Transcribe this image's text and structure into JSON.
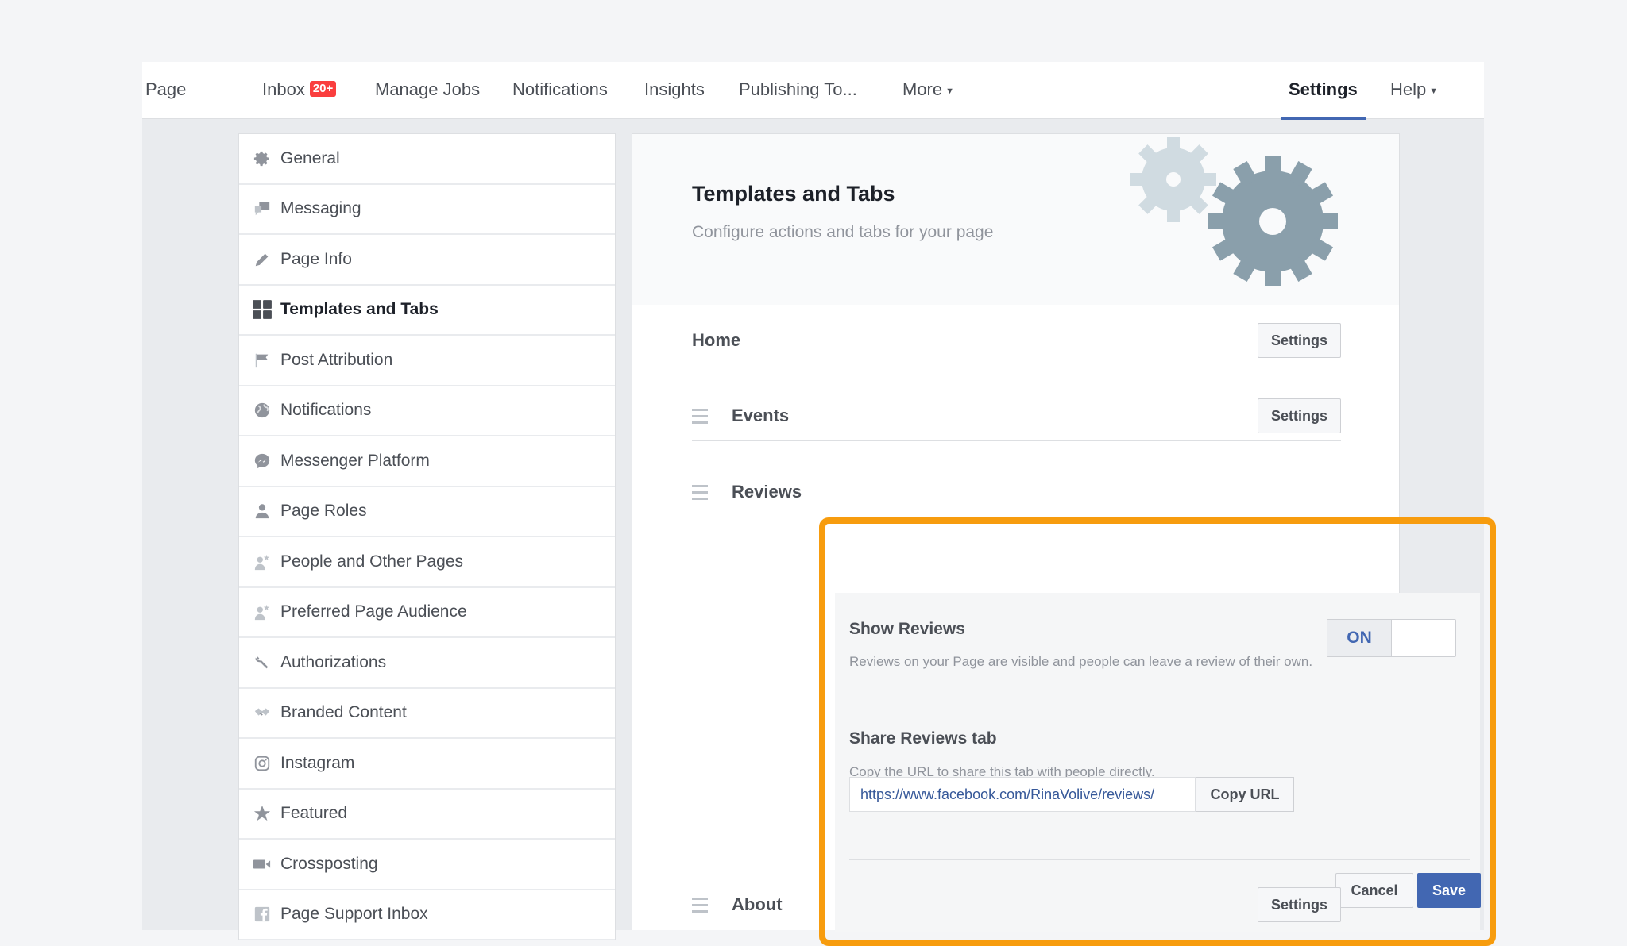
{
  "topnav": {
    "items": [
      {
        "label": "Page"
      },
      {
        "label": "Inbox",
        "badge": "20+"
      },
      {
        "label": "Manage Jobs"
      },
      {
        "label": "Notifications"
      },
      {
        "label": "Insights"
      },
      {
        "label": "Publishing To..."
      },
      {
        "label": "More"
      }
    ],
    "right": [
      {
        "label": "Settings",
        "active": true
      },
      {
        "label": "Help"
      }
    ]
  },
  "sidebar": {
    "items": [
      {
        "label": "General",
        "icon": "gear-icon"
      },
      {
        "label": "Messaging",
        "icon": "chat-bubbles-icon"
      },
      {
        "label": "Page Info",
        "icon": "pencil-icon"
      },
      {
        "label": "Templates and Tabs",
        "icon": "grid-icon",
        "active": true
      },
      {
        "label": "Post Attribution",
        "icon": "flag-icon"
      },
      {
        "label": "Notifications",
        "icon": "globe-icon"
      },
      {
        "label": "Messenger Platform",
        "icon": "messenger-icon"
      },
      {
        "label": "Page Roles",
        "icon": "person-icon"
      },
      {
        "label": "People and Other Pages",
        "icon": "person-star-icon"
      },
      {
        "label": "Preferred Page Audience",
        "icon": "person-star-icon"
      },
      {
        "label": "Authorizations",
        "icon": "wrench-icon"
      },
      {
        "label": "Branded Content",
        "icon": "handshake-icon"
      },
      {
        "label": "Instagram",
        "icon": "instagram-icon"
      },
      {
        "label": "Featured",
        "icon": "star-icon"
      },
      {
        "label": "Crossposting",
        "icon": "video-camera-icon"
      },
      {
        "label": "Page Support Inbox",
        "icon": "facebook-icon"
      }
    ]
  },
  "main": {
    "title": "Templates and Tabs",
    "subtitle": "Configure actions and tabs for your page",
    "tabs": [
      {
        "label": "Home",
        "button": "Settings"
      },
      {
        "label": "Events",
        "button": "Settings"
      },
      {
        "label": "Reviews"
      },
      {
        "label": "About",
        "button": "Settings"
      }
    ],
    "reviews": {
      "show_label": "Show Reviews",
      "show_desc": "Reviews on your Page are visible and people can leave a review of their own.",
      "toggle_state": "ON",
      "share_label": "Share Reviews tab",
      "share_desc": "Copy the URL to share this tab with people directly.",
      "url_value": "https://www.facebook.com/RinaVolive/reviews/",
      "copy_button": "Copy URL",
      "cancel_button": "Cancel",
      "save_button": "Save"
    }
  },
  "colors": {
    "accent": "#4267b2",
    "highlight": "#f79c0e",
    "badge": "#fa3e3e"
  }
}
